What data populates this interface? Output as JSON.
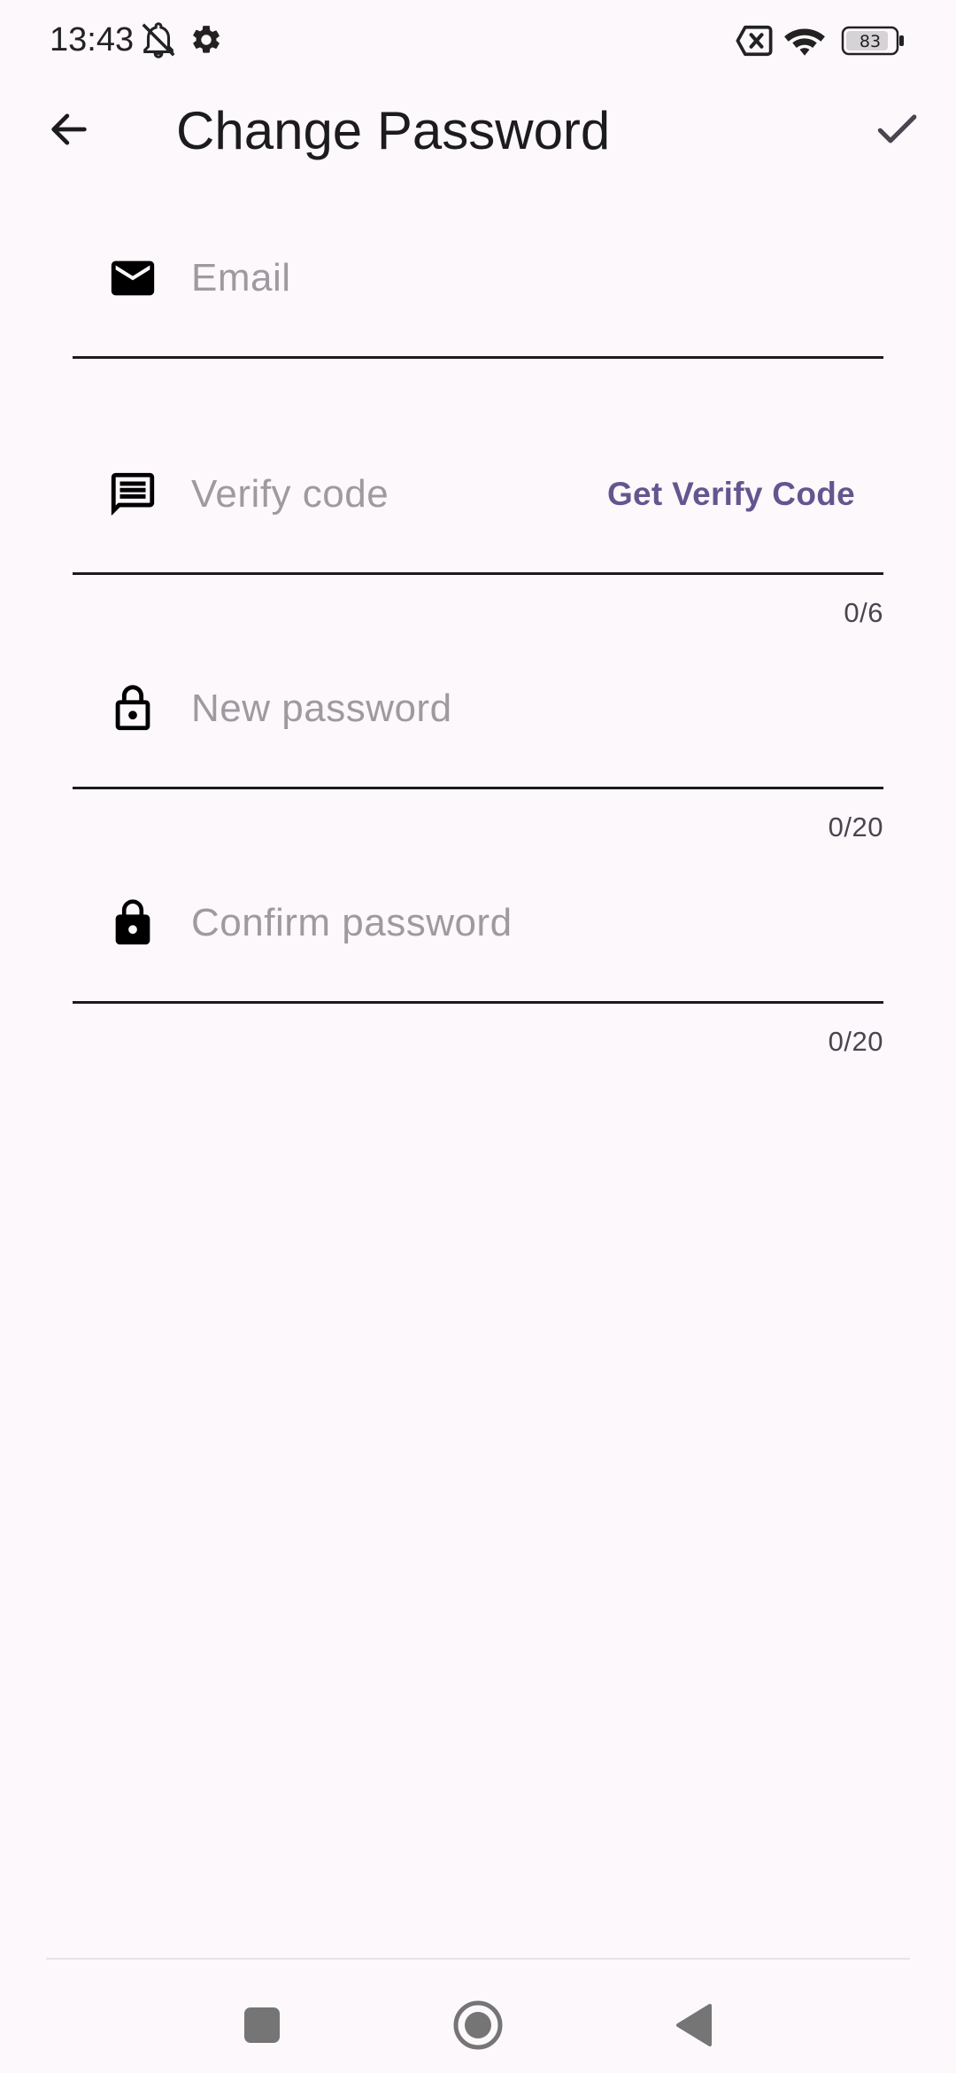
{
  "status_bar": {
    "time": "13:43",
    "battery": "83",
    "icons": [
      "bell-off-icon",
      "gear-icon",
      "no-sim-icon",
      "wifi-icon",
      "battery-icon"
    ]
  },
  "app_bar": {
    "title": "Change Password",
    "back_icon": "arrow-left-icon",
    "confirm_icon": "check-icon"
  },
  "form": {
    "email": {
      "placeholder": "Email",
      "value": "",
      "icon": "mail-icon"
    },
    "verify_code": {
      "placeholder": "Verify code",
      "value": "",
      "icon": "message-icon",
      "action_label": "Get Verify Code",
      "counter": "0/6"
    },
    "new_password": {
      "placeholder": "New password",
      "value": "",
      "icon": "lock-outline-icon",
      "counter": "0/20"
    },
    "confirm_password": {
      "placeholder": "Confirm password",
      "value": "",
      "icon": "lock-filled-icon",
      "counter": "0/20"
    }
  },
  "nav_bar": {
    "icons": [
      "recents-square-icon",
      "home-circle-icon",
      "back-triangle-icon"
    ]
  },
  "colors": {
    "background": "#fdf8fc",
    "accent": "#65558f",
    "text": "#1c1b1f",
    "placeholder": "#9e9a9f"
  }
}
